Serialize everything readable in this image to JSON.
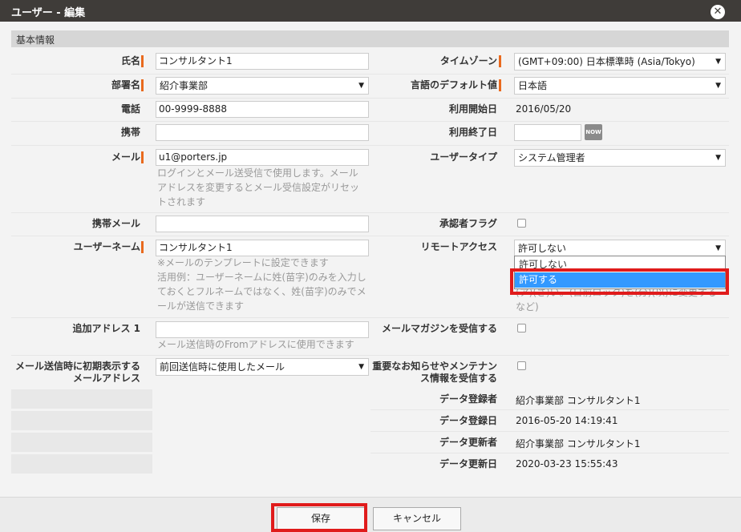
{
  "window": {
    "title": "ユーザー - 編集"
  },
  "section": {
    "title": "基本情報"
  },
  "left": {
    "name": {
      "label": "氏名",
      "value": "コンサルタント1"
    },
    "department": {
      "label": "部署名",
      "value": "紹介事業部"
    },
    "phone": {
      "label": "電話",
      "value": "00-9999-8888"
    },
    "mobile": {
      "label": "携帯",
      "value": ""
    },
    "email": {
      "label": "メール",
      "value": "u1@porters.jp",
      "hint1": "ログインとメール送受信で使用します。メール",
      "hint2": "アドレスを変更するとメール受信設定がリセッ",
      "hint3": "トされます"
    },
    "mobile_mail": {
      "label": "携帯メール",
      "value": ""
    },
    "username": {
      "label": "ユーザーネーム",
      "value": "コンサルタント1",
      "hint1": "※メールのテンプレートに設定できます",
      "hint2": "活用例：ユーザーネームに姓(苗字)のみを入力し",
      "hint3": "ておくとフルネームではなく、姓(苗字)のみでメ",
      "hint4": "ールが送信できます"
    },
    "additional_address": {
      "label": "追加アドレス 1",
      "value": "",
      "hint": "メール送信時のFromアドレスに使用できます"
    },
    "default_mail": {
      "label1": "メール送信時に初期表示する",
      "label2": "メールアドレス",
      "value": "前回送信時に使用したメール"
    }
  },
  "right": {
    "timezone": {
      "label": "タイムゾーン",
      "value": "(GMT+09:00) 日本標準時 (Asia/Tokyo)"
    },
    "language": {
      "label": "言語のデフォルト値",
      "value": "日本語"
    },
    "start_date": {
      "label": "利用開始日",
      "value": "2016/05/20"
    },
    "end_date": {
      "label": "利用終了日",
      "value": "",
      "now_label": "NOW"
    },
    "user_type": {
      "label": "ユーザータイプ",
      "value": "システム管理者"
    },
    "approver_flag": {
      "label": "承認者フラグ"
    },
    "remote_access": {
      "label": "リモートアクセス",
      "value": "許可しない",
      "options": [
        "許可しない",
        "許可する"
      ],
      "behind_text1": "(ア)(さ)い。(日前ロック)を(分)(以)に変更する",
      "behind_text2": "など)"
    },
    "mail_magazine": {
      "label": "メールマガジンを受信する"
    },
    "important_notice": {
      "label1": "重要なお知らせやメンテナン",
      "label2": "ス情報を受信する"
    },
    "created_by": {
      "label": "データ登録者",
      "value": "紹介事業部 コンサルタント1"
    },
    "created_at": {
      "label": "データ登録日",
      "value": "2016-05-20 14:19:41"
    },
    "updated_by": {
      "label": "データ更新者",
      "value": "紹介事業部 コンサルタント1"
    },
    "updated_at": {
      "label": "データ更新日",
      "value": "2020-03-23 15:55:43"
    }
  },
  "footer": {
    "save": "保存",
    "cancel": "キャンセル"
  },
  "colors": {
    "titlebar": "#3f3c39",
    "required_marker": "#e96a1e",
    "highlight": "#e01b1b",
    "selected_option": "#3399ff"
  }
}
